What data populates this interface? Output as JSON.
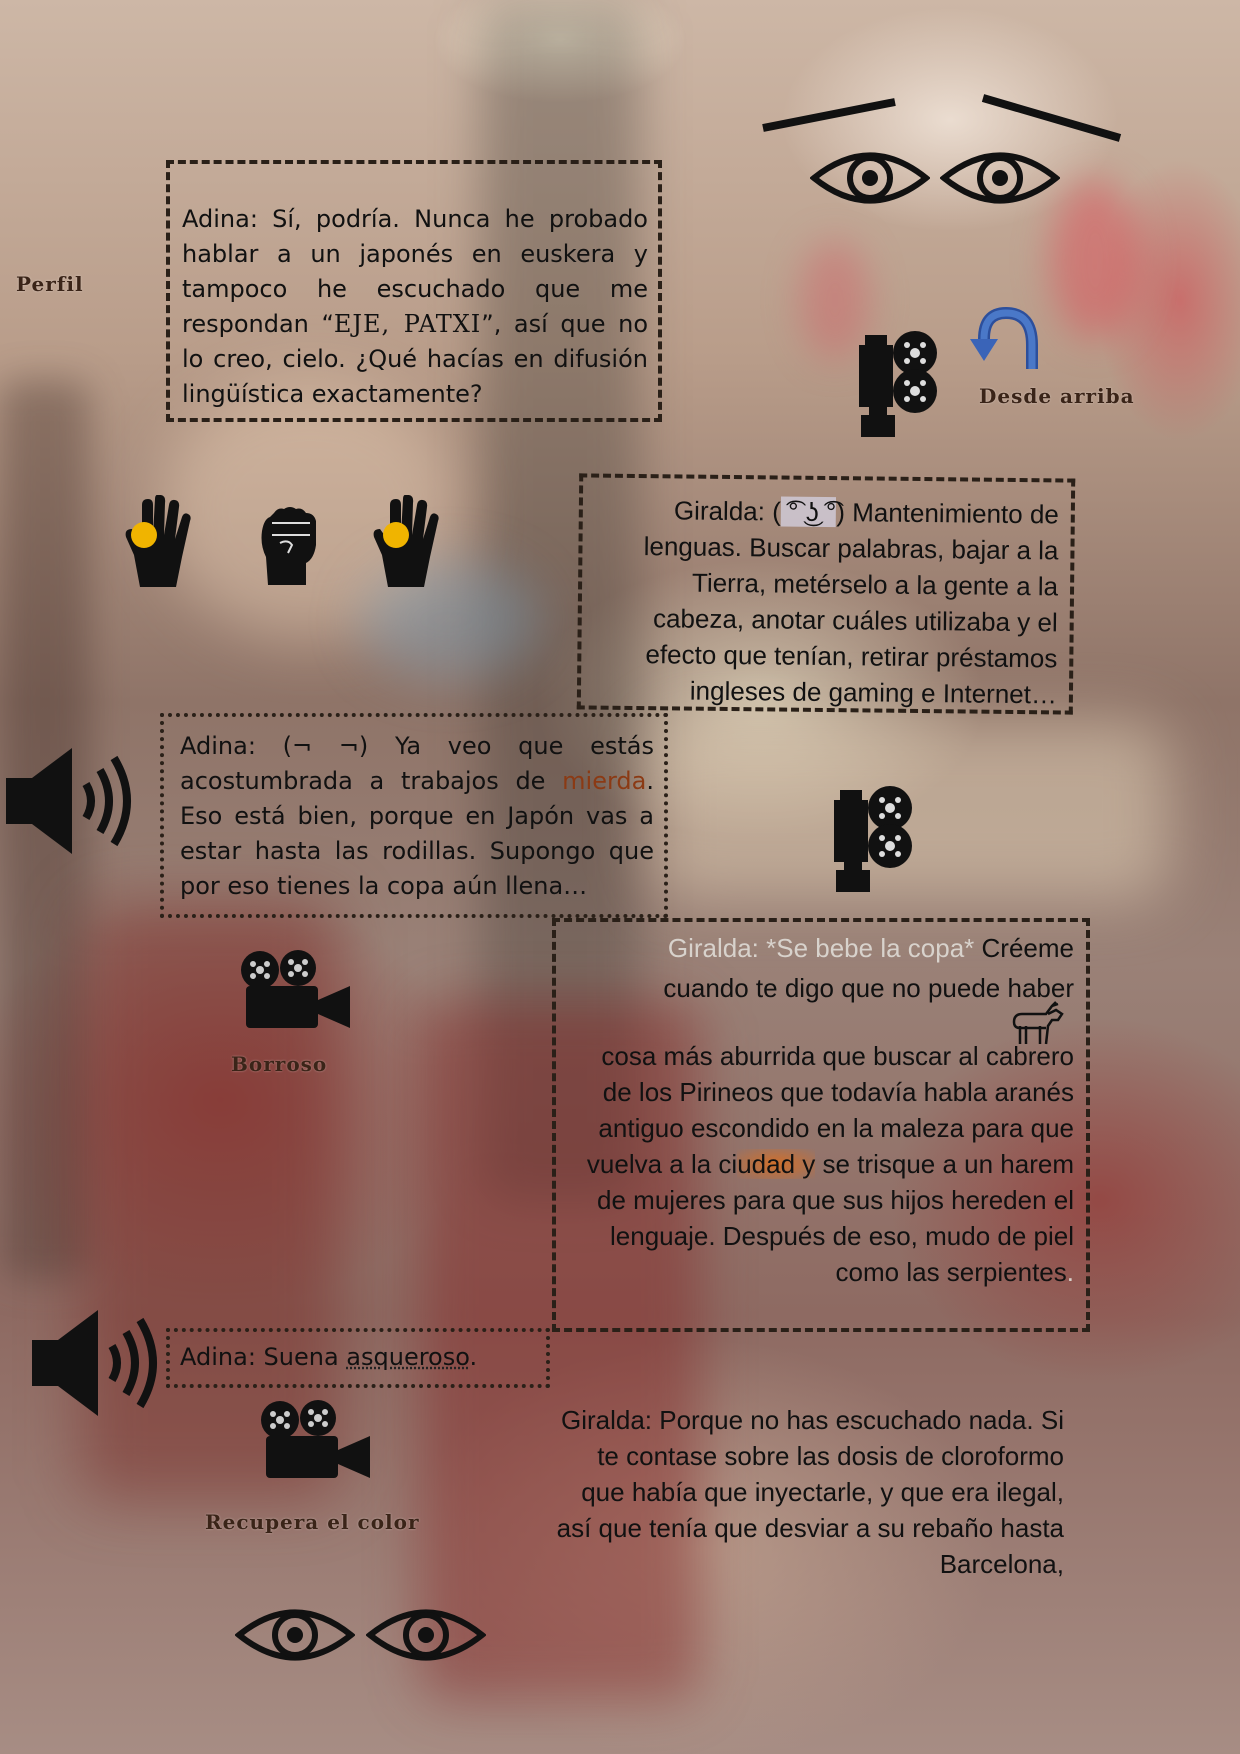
{
  "labels": {
    "perfil": "Perfil",
    "desde_arriba": "Desde arriba",
    "borroso": "Borroso",
    "recupera": "Recupera el color"
  },
  "dialogue": {
    "adina1": {
      "speaker": "Adina:",
      "text_a": " Sí, podría. Nunca he probado hablar a un japonés en euskera y tampoco he escuchado que me respondan “",
      "emph": "EJE, PATXI",
      "text_b": "”, así que no lo creo, cielo. ¿Qué hacías en difusión lingüística exactamente?"
    },
    "giralda1": {
      "speaker": "Giralda: (",
      "face": " ͡° ͜ʖ ͡°",
      "text": ") Mantenimiento de lenguas. Buscar palabras, bajar a la Tierra, metérselo a la gente a la cabeza, anotar cuáles utilizaba y el efecto que tenían, retirar préstamos ingleses de gaming e Internet…"
    },
    "adina2": {
      "speaker": "Adina:",
      "text_a": " (¬ ¬) Ya veo que estás acostumbrada a trabajos de ",
      "emph": "mierda",
      "text_b": ". Eso está bien, porque en Japón vas a estar hasta las rodillas. Supongo que por eso tienes la copa aún llena…"
    },
    "giralda2": {
      "faded": "Giralda: *Se bebe la copa*",
      "line1": " Créeme",
      "line2": "cuando te digo que no puede haber",
      "body_a": "cosa más aburrida que buscar al cabrero de los Pirineos que todavía habla aranés antiguo escondido en la maleza para que vuelva a la ci",
      "smudged": "udad y",
      "body_b": " se trisque a un harem de mujeres para que sus hijos hereden el lenguaje. Después de eso, mudo de piel como las serpientes",
      "end": "."
    },
    "adina3": {
      "speaker": "Adina:",
      "text_a": " Suena ",
      "emph": "asqueroso",
      "text_b": "."
    },
    "giralda3": {
      "text": "Giralda: Porque no has escuchado nada. Si te contase sobre las dosis de cloroformo que había que inyectarle, y que era ilegal, así que tenía que desviar a su rebaño hasta Barcelona,"
    }
  },
  "icons": [
    "eyebrow-icon",
    "eye-icon",
    "film-projector-icon",
    "curved-arrow-icon",
    "raised-hand-icon",
    "fist-icon",
    "speaker-icon",
    "film-camera-icon",
    "goat-icon"
  ],
  "colors": {
    "frame": "#2a2018",
    "label": "#3a2418",
    "emphasis_orange": "#8b3a14",
    "hand_dot": "#f0b400",
    "arrow_blue": "#3a64b8"
  }
}
